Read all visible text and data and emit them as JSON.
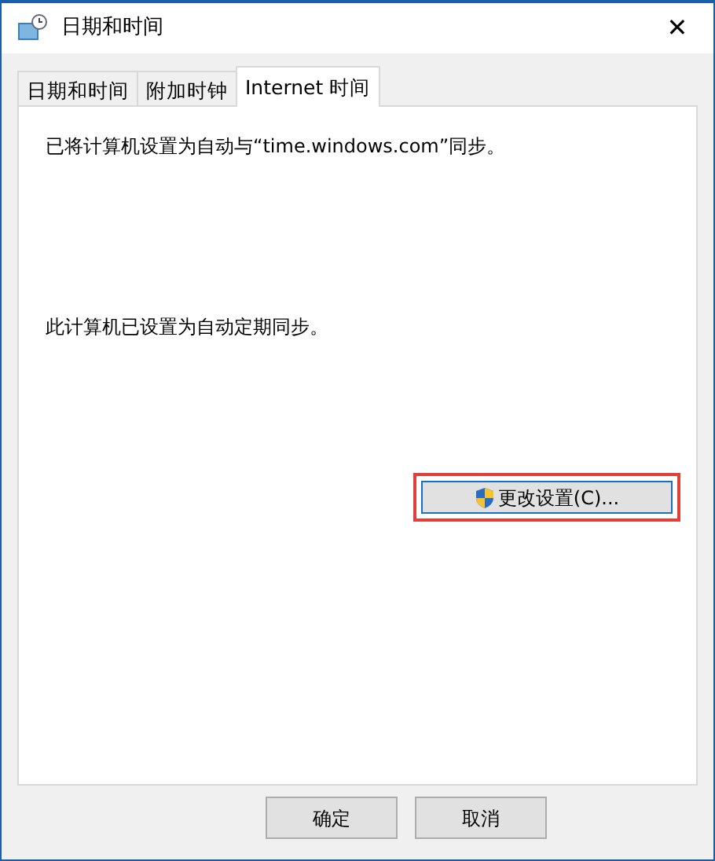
{
  "window": {
    "title": "日期和时间",
    "close": "✕"
  },
  "tabs": [
    {
      "label": "日期和时间",
      "selected": false
    },
    {
      "label": "附加时钟",
      "selected": false
    },
    {
      "label": "Internet 时间",
      "selected": true
    }
  ],
  "panel": {
    "status": "已将计算机设置为自动与“time.windows.com”同步。",
    "sync_note": "此计算机已设置为自动定期同步。",
    "change_button": {
      "label": "更改设置(C)...",
      "highlighted": true
    }
  },
  "buttons": [
    {
      "label": "确定"
    },
    {
      "label": "取消"
    }
  ]
}
